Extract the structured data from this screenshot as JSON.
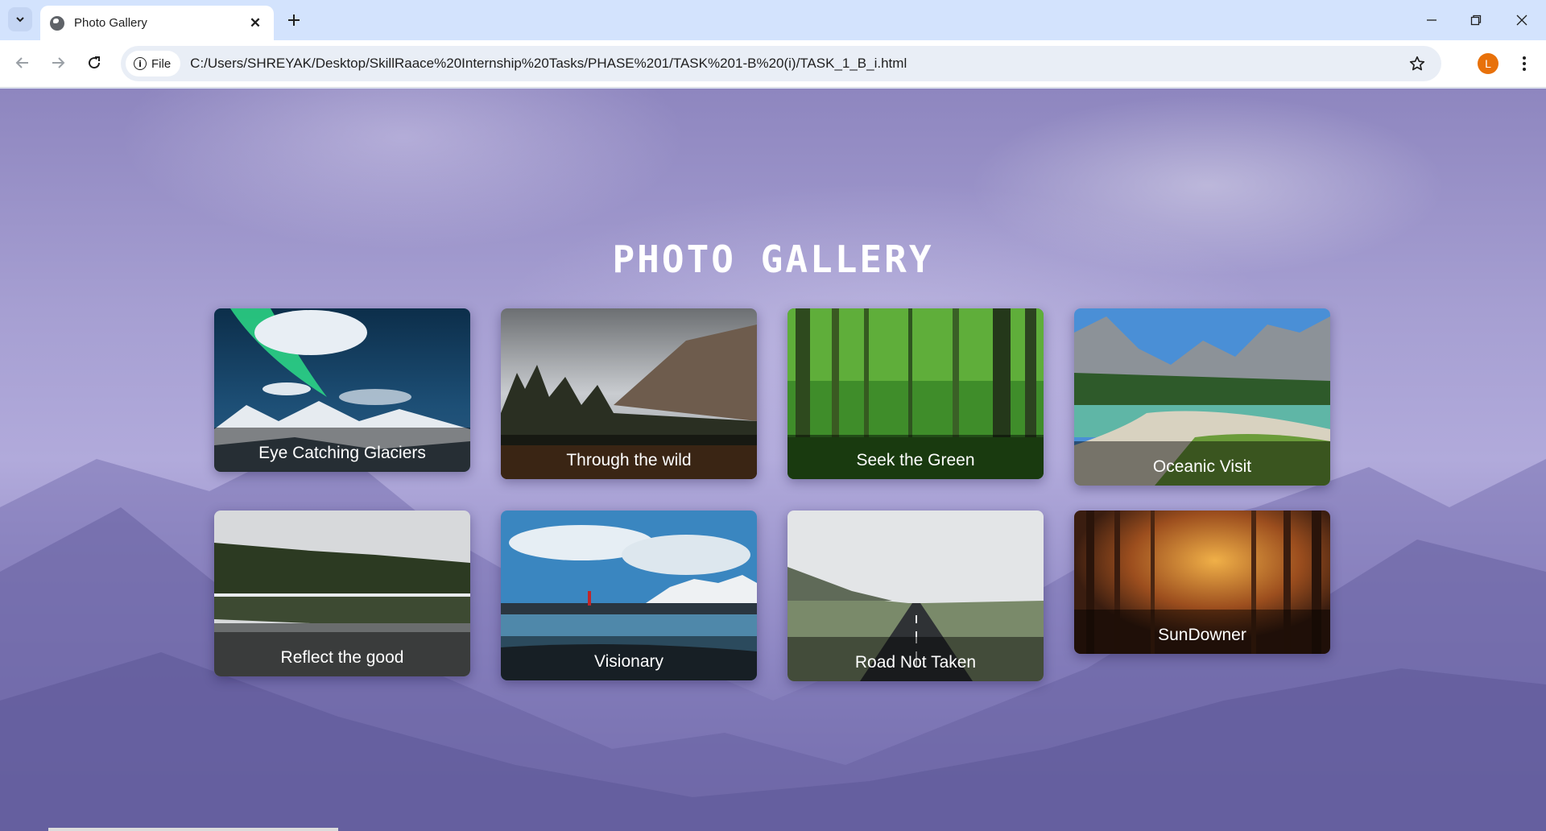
{
  "browser": {
    "tab_title": "Photo Gallery",
    "site_chip": "File",
    "url": "C:/Users/SHREYAK/Desktop/SkillRaace%20Internship%20Tasks/PHASE%201/TASK%201-B%20(i)/TASK_1_B_i.html",
    "profile_initial": "L"
  },
  "page": {
    "title": "PHOTO GALLERY"
  },
  "gallery": [
    {
      "caption": "Eye Catching Glaciers"
    },
    {
      "caption": "Through the wild"
    },
    {
      "caption": "Seek the Green"
    },
    {
      "caption": "Oceanic Visit"
    },
    {
      "caption": "Reflect the good"
    },
    {
      "caption": "Visionary"
    },
    {
      "caption": "Road Not Taken"
    },
    {
      "caption": "SunDowner"
    }
  ]
}
